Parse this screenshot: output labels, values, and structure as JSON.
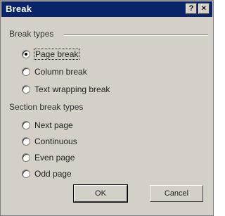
{
  "window": {
    "title": "Break",
    "help_button": "?",
    "close_button": "×"
  },
  "break_types": {
    "label": "Break types",
    "options": [
      {
        "label": "Page break",
        "checked": true
      },
      {
        "label": "Column break",
        "checked": false
      },
      {
        "label": "Text wrapping break",
        "checked": false
      }
    ]
  },
  "section_break_types": {
    "label": "Section break types",
    "options": [
      {
        "label": "Next page",
        "checked": false
      },
      {
        "label": "Continuous",
        "checked": false
      },
      {
        "label": "Even page",
        "checked": false
      },
      {
        "label": "Odd page",
        "checked": false
      }
    ]
  },
  "buttons": {
    "ok": "OK",
    "cancel": "Cancel"
  },
  "colors": {
    "titlebar": "#0a246a",
    "dialog_bg": "#d4d0c8"
  }
}
